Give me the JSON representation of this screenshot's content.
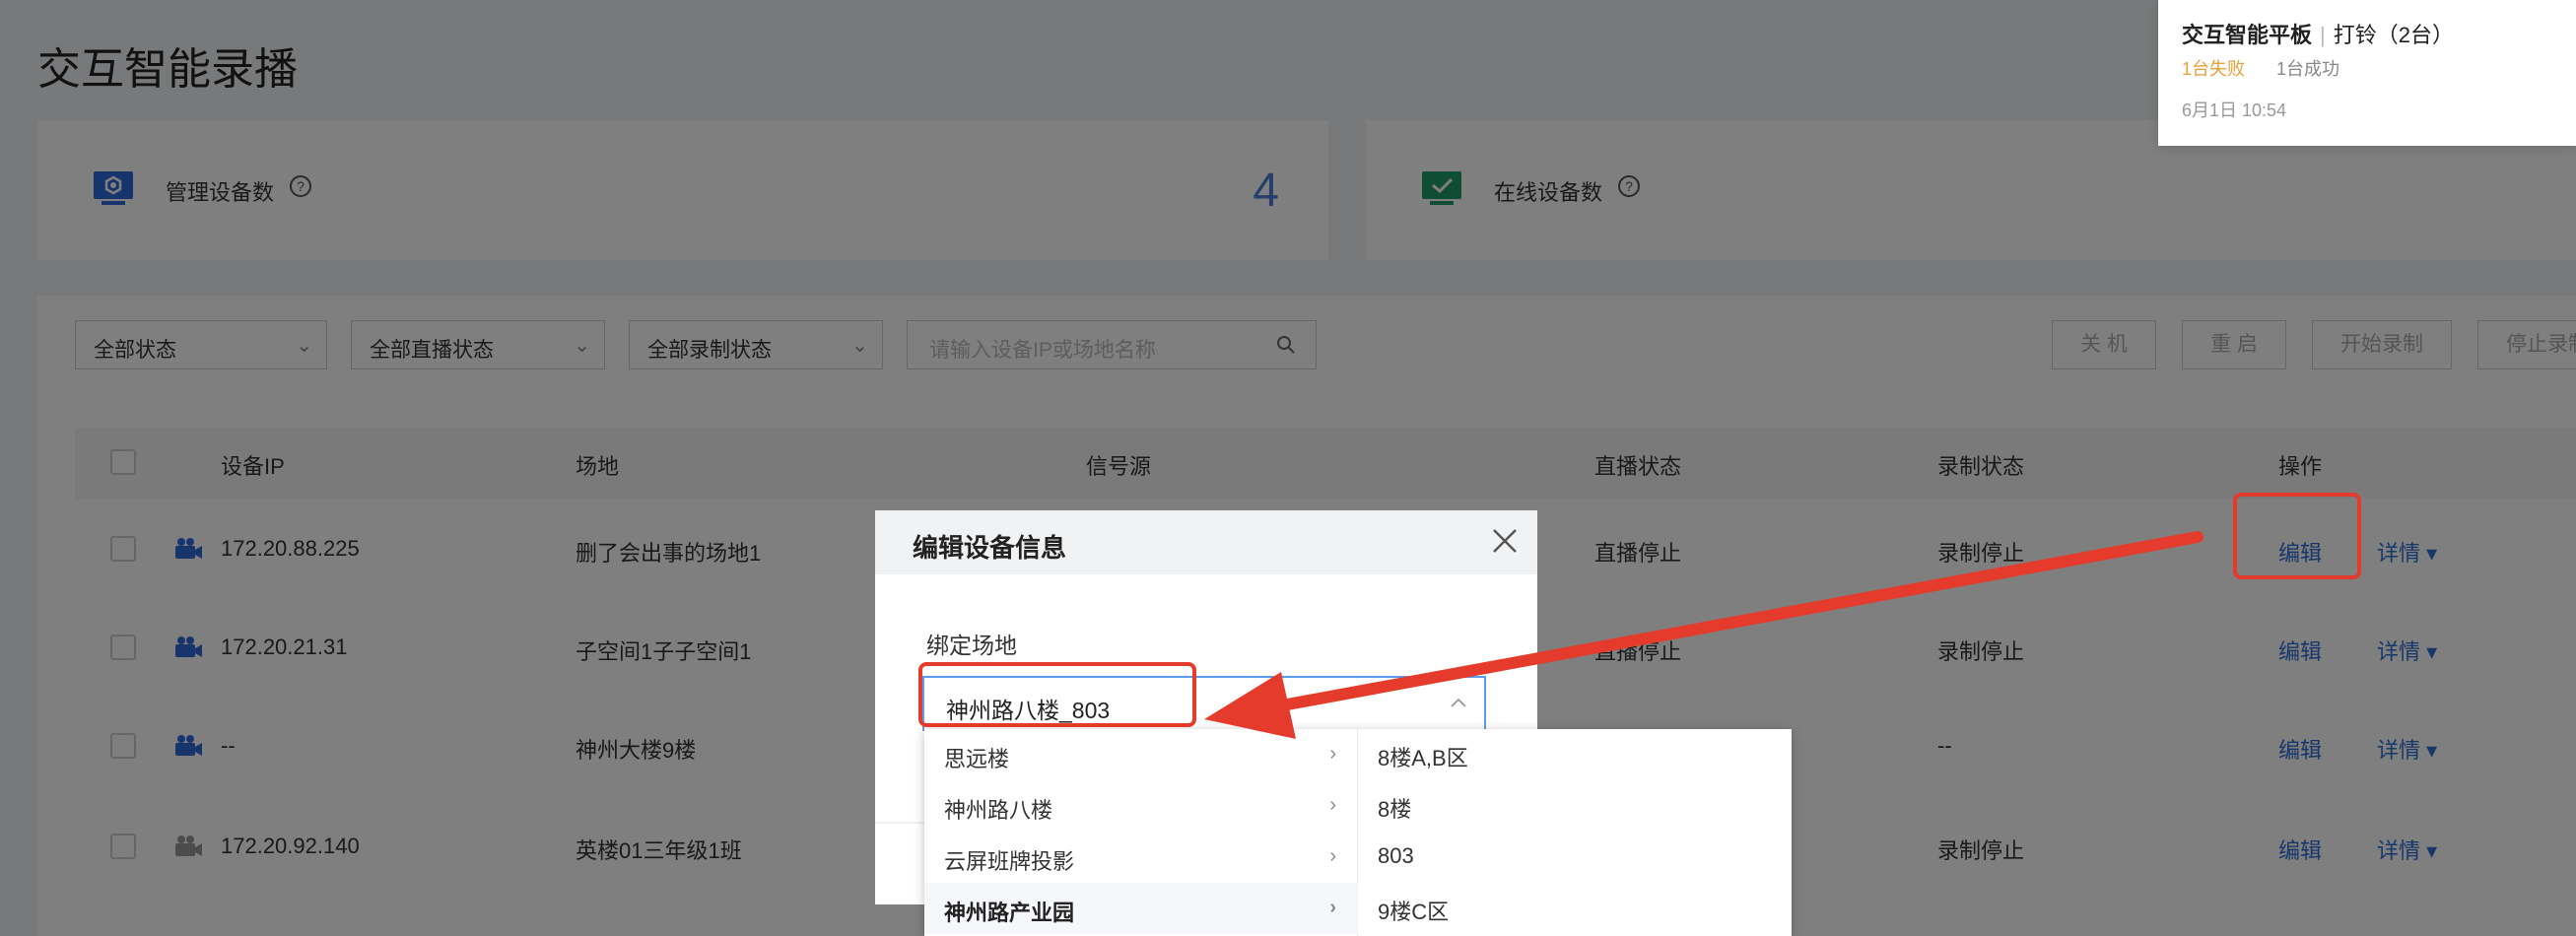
{
  "page": {
    "title": "交互智能录播"
  },
  "stats": {
    "managed_label": "管理设备数",
    "managed_count": "4",
    "online_label": "在线设备数",
    "help_glyph": "?"
  },
  "filters": {
    "all_status": "全部状态",
    "all_live_status": "全部直播状态",
    "all_record_status": "全部录制状态",
    "search_placeholder": "请输入设备IP或场地名称"
  },
  "toolbar": {
    "shutdown": "关 机",
    "restart": "重 启",
    "start_record": "开始录制",
    "stop_record": "停止录制"
  },
  "table": {
    "headers": [
      "设备IP",
      "场地",
      "信号源",
      "直播状态",
      "录制状态",
      "操作"
    ],
    "rows": [
      {
        "ip": "172.20.88.225",
        "venue": "删了会出事的场地1",
        "live": "直播停止",
        "record": "录制停止",
        "edit": "编辑",
        "details": "详情"
      },
      {
        "ip": "172.20.21.31",
        "venue": "子空间1子子空间1",
        "live": "直播停止",
        "record": "录制停止",
        "edit": "编辑",
        "details": "详情"
      },
      {
        "ip": "--",
        "venue": "神州大楼9楼",
        "live": "",
        "record": "--",
        "edit": "编辑",
        "details": "详情"
      },
      {
        "ip": "172.20.92.140",
        "venue": "英楼01三年级1班",
        "live": "",
        "record": "录制停止",
        "edit": "编辑",
        "details": "详情"
      }
    ]
  },
  "dialog": {
    "title": "编辑设备信息",
    "field_label": "绑定场地",
    "selected_value": "神州路八楼_803"
  },
  "cascader": {
    "level1": [
      "思远楼",
      "神州路八楼",
      "云屏班牌投影",
      "神州路产业园"
    ],
    "active_index": 3,
    "level2": [
      "8楼A,B区",
      "8楼",
      "803",
      "9楼C区"
    ]
  },
  "notification": {
    "title": "交互智能平板",
    "action": "打铃（2台）",
    "fail": "1台失败",
    "success": "1台成功",
    "time": "6月1日 10:54"
  },
  "colors": {
    "accent": "#2e6fd6",
    "annotation": "#e53b2c",
    "warning": "#e8a13a"
  }
}
